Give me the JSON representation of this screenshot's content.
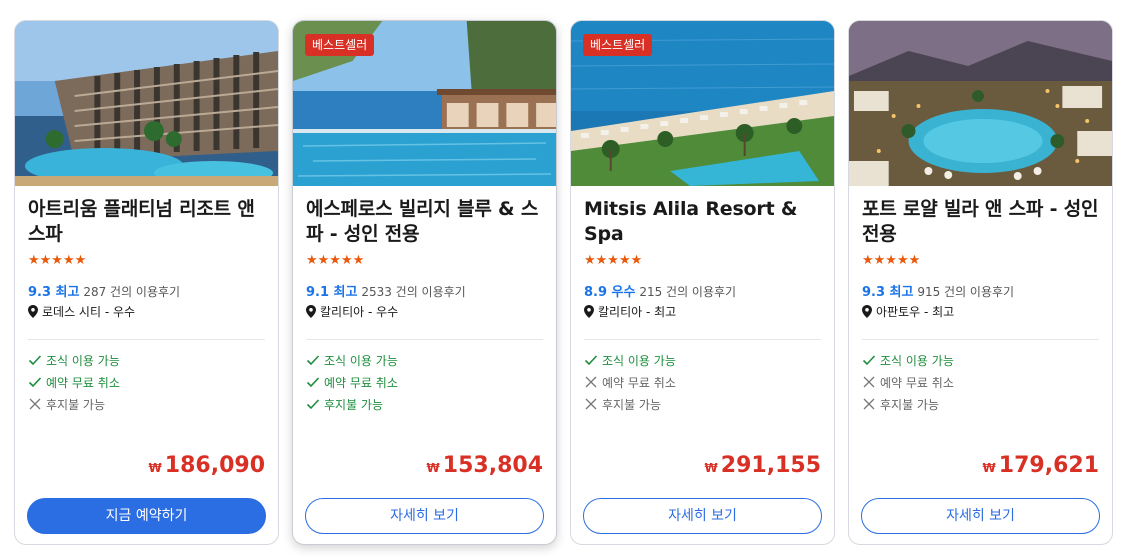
{
  "cards": [
    {
      "badge": "",
      "name": "아트리움 플래티넘 리조트 앤 스파",
      "stars": "★★★★★",
      "score": "9.3 최고",
      "reviews": "287 건의 이용후기",
      "location": "로데스 시티 - 우수",
      "features": [
        {
          "label": "조식 이용 가능",
          "available": true
        },
        {
          "label": "예약 무료 취소",
          "available": true
        },
        {
          "label": "후지불 가능",
          "available": false
        }
      ],
      "currency": "₩",
      "price": "186,090",
      "button": "지금 예약하기"
    },
    {
      "badge": "베스트셀러",
      "name": "에스페로스 빌리지 블루 & 스파 - 성인 전용",
      "stars": "★★★★★",
      "score": "9.1 최고",
      "reviews": "2533 건의 이용후기",
      "location": "칼리티아 - 우수",
      "features": [
        {
          "label": "조식 이용 가능",
          "available": true
        },
        {
          "label": "예약 무료 취소",
          "available": true
        },
        {
          "label": "후지불 가능",
          "available": true
        }
      ],
      "currency": "₩",
      "price": "153,804",
      "button": "자세히 보기"
    },
    {
      "badge": "베스트셀러",
      "name": "Mitsis Alila Resort & Spa",
      "stars": "★★★★★",
      "score": "8.9 우수",
      "reviews": "215 건의 이용후기",
      "location": "칼리티아 - 최고",
      "features": [
        {
          "label": "조식 이용 가능",
          "available": true
        },
        {
          "label": "예약 무료 취소",
          "available": false
        },
        {
          "label": "후지불 가능",
          "available": false
        }
      ],
      "currency": "₩",
      "price": "291,155",
      "button": "자세히 보기"
    },
    {
      "badge": "",
      "name": "포트 로얄 빌라 앤 스파 - 성인 전용",
      "stars": "★★★★★",
      "score": "9.3 최고",
      "reviews": "915 건의 이용후기",
      "location": "아판토우 - 최고",
      "features": [
        {
          "label": "조식 이용 가능",
          "available": true
        },
        {
          "label": "예약 무료 취소",
          "available": false
        },
        {
          "label": "후지불 가능",
          "available": false
        }
      ],
      "currency": "₩",
      "price": "179,621",
      "button": "자세히 보기"
    }
  ],
  "colors": {
    "accent": "#2b6de3",
    "price": "#d93025",
    "badge": "#d93025",
    "stars": "#e8590c",
    "available": "#1e8e3e"
  }
}
